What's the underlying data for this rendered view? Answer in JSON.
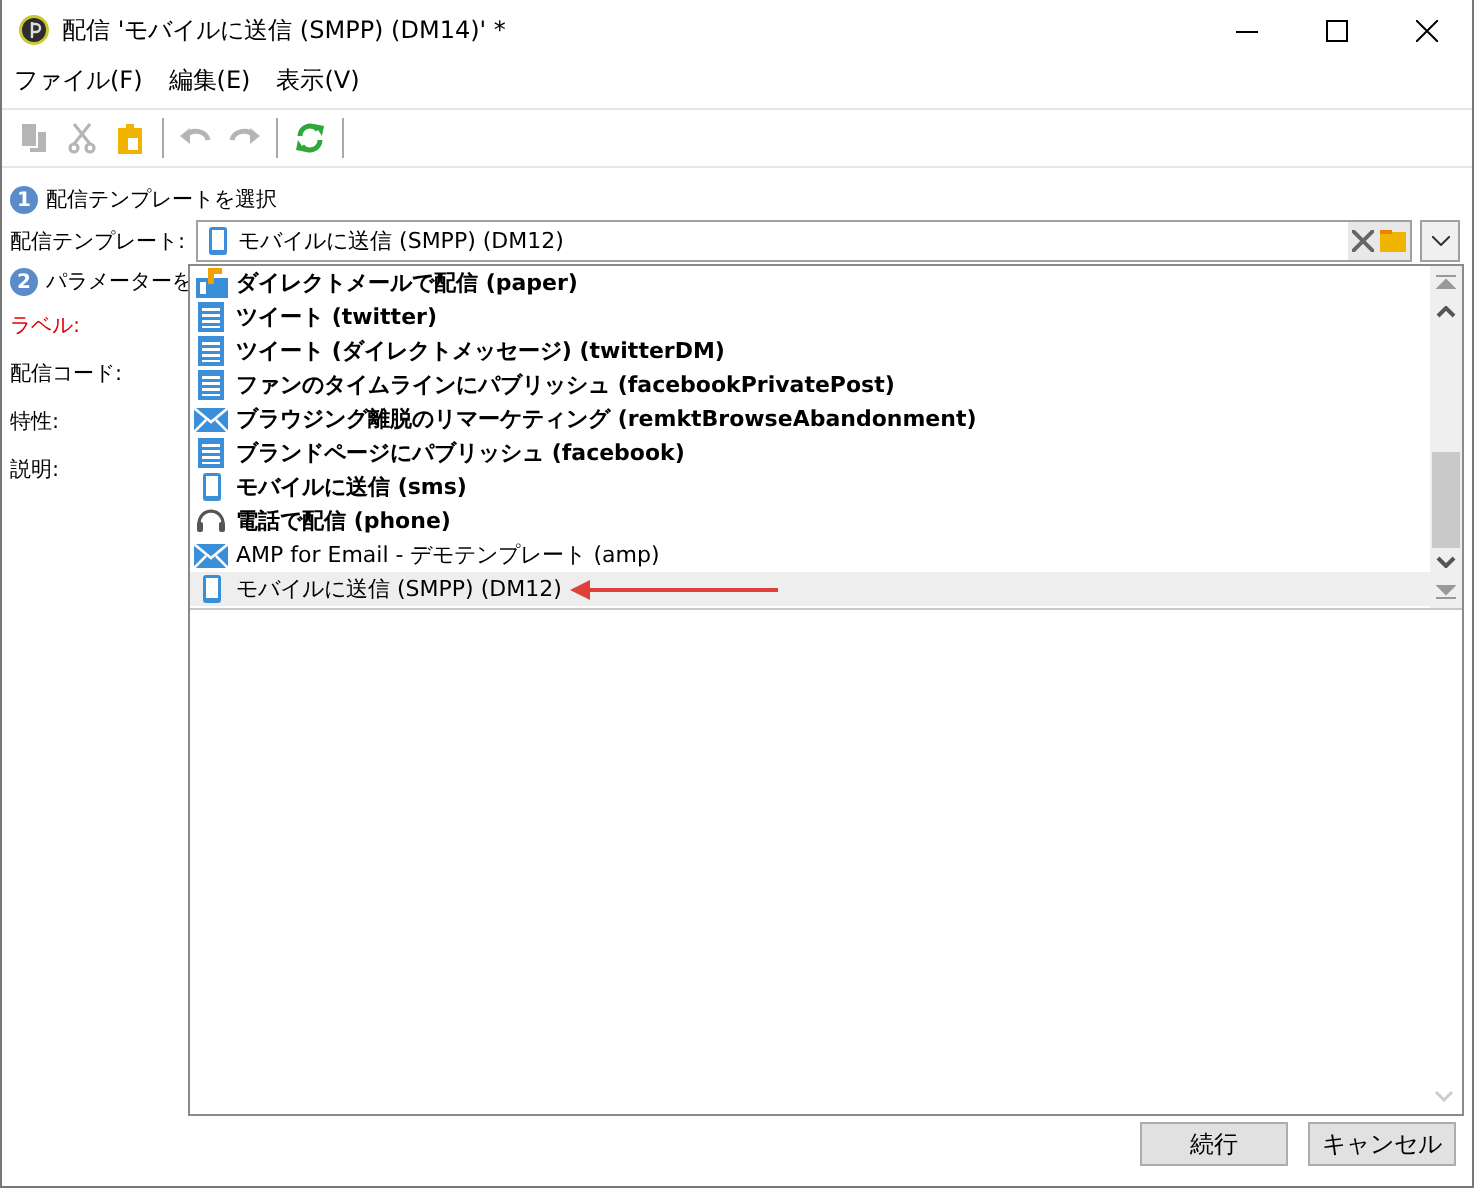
{
  "window": {
    "title": "配信 'モバイルに送信 (SMPP) (DM14)' *"
  },
  "menu": [
    "ファイル(F)",
    "編集(E)",
    "表示(V)"
  ],
  "toolbar": [
    {
      "kind": "copy",
      "disabled": true
    },
    {
      "kind": "cut",
      "disabled": true
    },
    {
      "kind": "paste",
      "disabled": false
    },
    {
      "kind": "sep"
    },
    {
      "kind": "undo",
      "disabled": true
    },
    {
      "kind": "redo",
      "disabled": true
    },
    {
      "kind": "sep"
    },
    {
      "kind": "refresh",
      "disabled": false
    },
    {
      "kind": "sep"
    }
  ],
  "steps": [
    {
      "number": "1",
      "label": "配信テンプレートを選択"
    },
    {
      "number": "2",
      "label": "パラメーターを"
    }
  ],
  "template_field": {
    "label": "配信テンプレート:",
    "value": "モバイルに送信 (SMPP) (DM12)",
    "kind": "mobile"
  },
  "fields": [
    {
      "label": "ラベル:",
      "required": true
    },
    {
      "label": "配信コード:",
      "required": false
    },
    {
      "label": "特性:",
      "required": false
    },
    {
      "label": "説明:",
      "required": false
    }
  ],
  "dropdown": {
    "items": [
      {
        "kind": "paper",
        "label": "ダイレクトメールで配信 (paper)",
        "bold": true,
        "selected": false
      },
      {
        "kind": "document",
        "label": "ツイート (twitter)",
        "bold": true,
        "selected": false
      },
      {
        "kind": "document",
        "label": "ツイート (ダイレクトメッセージ) (twitterDM)",
        "bold": true,
        "selected": false
      },
      {
        "kind": "document",
        "label": "ファンのタイムラインにパブリッシュ (facebookPrivatePost)",
        "bold": true,
        "selected": false
      },
      {
        "kind": "mail",
        "label": "ブラウジング離脱のリマーケティング (remktBrowseAbandonment)",
        "bold": true,
        "selected": false
      },
      {
        "kind": "document",
        "label": "ブランドページにパブリッシュ (facebook)",
        "bold": true,
        "selected": false
      },
      {
        "kind": "mobile",
        "label": "モバイルに送信 (sms)",
        "bold": true,
        "selected": false
      },
      {
        "kind": "phone",
        "label": "電話で配信 (phone)",
        "bold": true,
        "selected": false
      },
      {
        "kind": "mail",
        "label": "AMP for Email - デモテンプレート (amp)",
        "bold": false,
        "selected": false
      },
      {
        "kind": "mobile",
        "label": "モバイルに送信 (SMPP) (DM12)",
        "bold": false,
        "selected": true
      }
    ]
  },
  "buttons": [
    "続行",
    "キャンセル"
  ]
}
